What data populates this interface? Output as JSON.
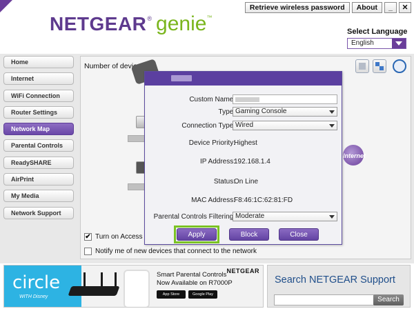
{
  "header": {
    "logo_brand": "NETGEAR",
    "logo_reg": "®",
    "logo_product": "genie",
    "logo_tm": "™",
    "retrieve_password_label": "Retrieve wireless password",
    "about_label": "About",
    "minimize_label": "_",
    "close_label": "✕",
    "language_label": "Select Language",
    "language_value": "English"
  },
  "sidebar": {
    "items": [
      {
        "label": "Home"
      },
      {
        "label": "Internet"
      },
      {
        "label": "WiFi Connection"
      },
      {
        "label": "Router Settings"
      },
      {
        "label": "Network Map"
      },
      {
        "label": "Parental Controls"
      },
      {
        "label": "ReadySHARE"
      },
      {
        "label": "AirPrint"
      },
      {
        "label": "My Media"
      },
      {
        "label": "Network Support"
      }
    ],
    "active_index": 4
  },
  "content": {
    "devices_label": "Number of devices C",
    "access_control_label": "Turn on Access C",
    "access_control_checked": true,
    "notify_label": "Notify me of new devices that connect to the network",
    "notify_checked": false
  },
  "dialog": {
    "custom_name_label": "Custom Name:",
    "type_label": "Type:",
    "type_value": "Gaming Console",
    "connection_type_label": "Connection Type:",
    "connection_type_value": "Wired",
    "device_priority_label": "Device Priority:",
    "device_priority_value": "Highest",
    "ip_label": "IP Address:",
    "ip_value": "192.168.1.4",
    "status_label": "Status:",
    "status_value": "On Line",
    "mac_label": "MAC Address:",
    "mac_value": "F8:46:1C:62:81:FD",
    "parental_label": "Parental Controls Filtering:",
    "parental_value": "Moderate",
    "apply_label": "Apply",
    "block_label": "Block",
    "close_label": "Close"
  },
  "ads": {
    "circle_brand": "circle",
    "circle_with": "WITH Disney",
    "netgear_mark": "NETGEAR",
    "line1": "Smart Parental Controls",
    "line2": "Now Available on R7000P",
    "app_store": "App Store",
    "google_play": "Google Play",
    "internet_badge": "Internet"
  },
  "support": {
    "title": "Search NETGEAR Support",
    "search_placeholder": "",
    "search_button": "Search"
  },
  "colors": {
    "brand_purple": "#5e3a8e",
    "genie_green": "#7ab51d",
    "apply_highlight": "#7bc323",
    "circle_blue": "#2db3e3"
  }
}
